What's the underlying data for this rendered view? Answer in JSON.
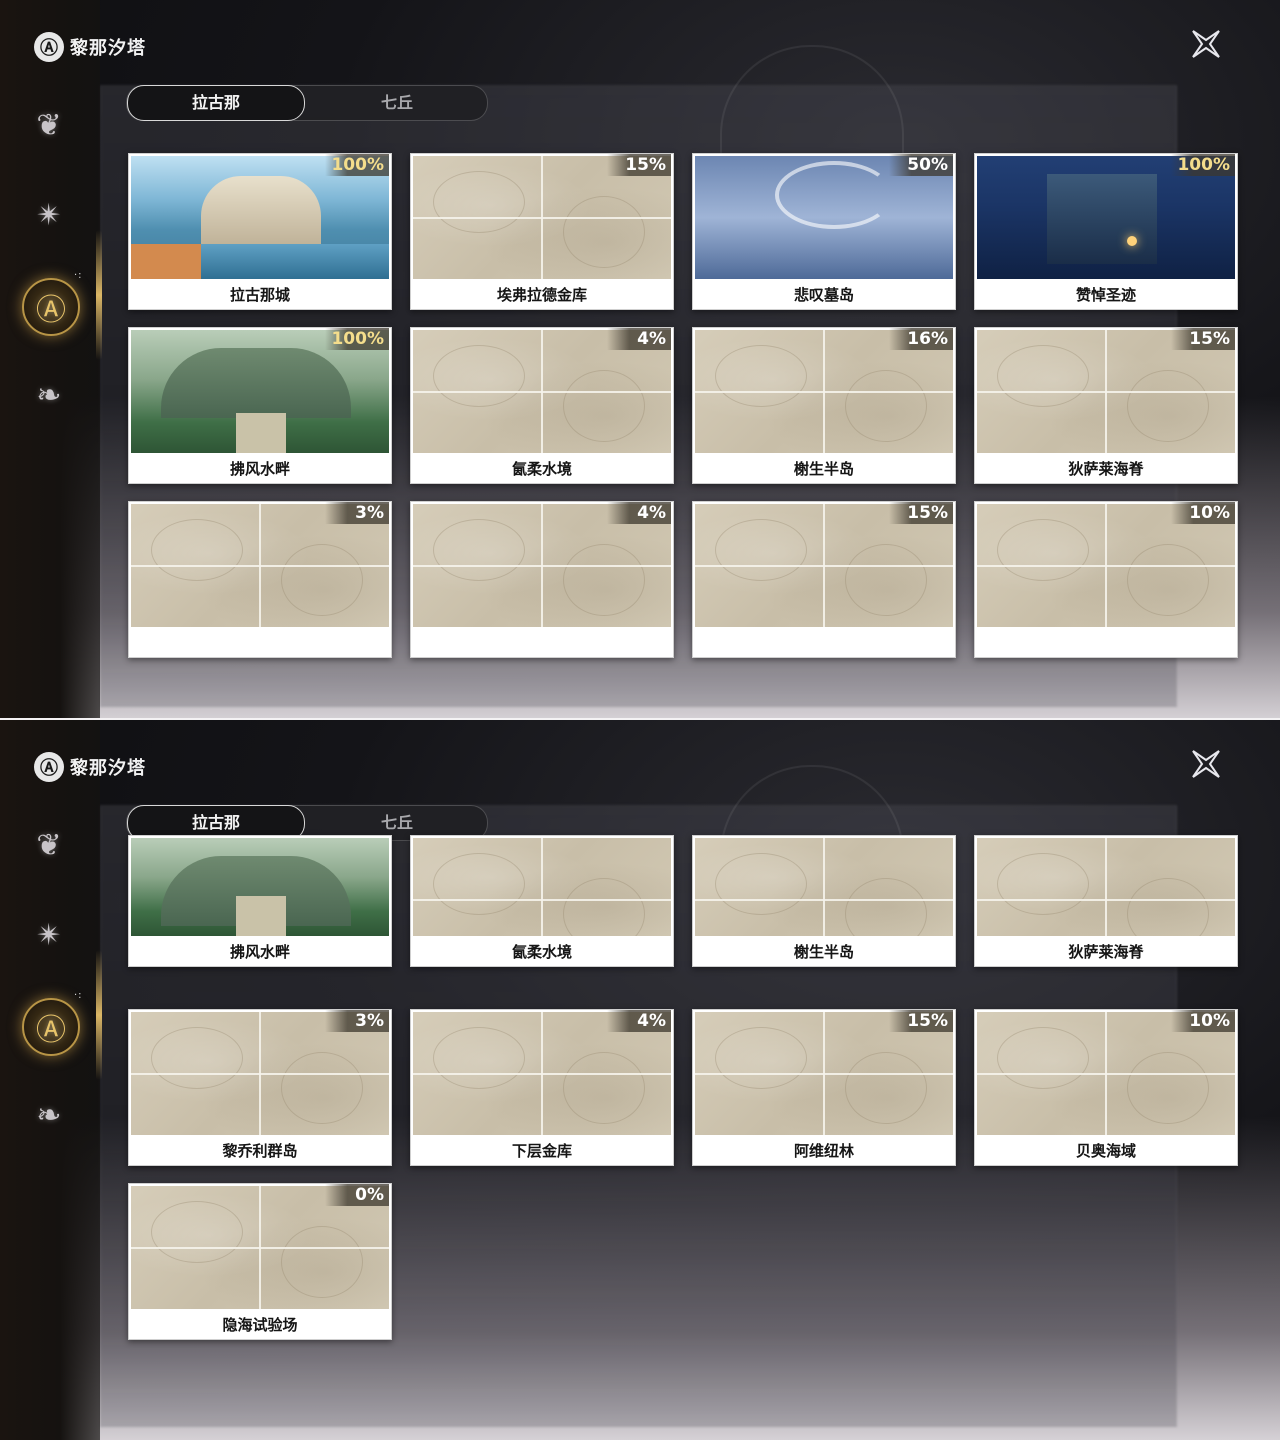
{
  "app": {
    "title": "黎那汐塔",
    "logo_glyph": "Ⓐ"
  },
  "tabs": [
    {
      "label": "拉古那",
      "active": true
    },
    {
      "label": "七丘",
      "active": false
    }
  ],
  "rail": [
    {
      "icon": "lotus-emblem-icon",
      "glyph": "❦"
    },
    {
      "icon": "star-emblem-icon",
      "glyph": "✴"
    },
    {
      "icon": "region-emblem-icon",
      "glyph": "Ⓐ",
      "active": true
    },
    {
      "icon": "bird-emblem-icon",
      "glyph": "❧"
    }
  ],
  "top_panel": {
    "cards": [
      {
        "name": "拉古那城",
        "progress": "100%",
        "scene": "city"
      },
      {
        "name": "埃弗拉德金库",
        "progress": "15%",
        "scene": "map"
      },
      {
        "name": "悲叹墓岛",
        "progress": "50%",
        "scene": "storm"
      },
      {
        "name": "赞悼圣迹",
        "progress": "100%",
        "scene": "night"
      },
      {
        "name": "拂风水畔",
        "progress": "100%",
        "scene": "garden"
      },
      {
        "name": "氤柔水境",
        "progress": "4%",
        "scene": "map"
      },
      {
        "name": "榭生半岛",
        "progress": "16%",
        "scene": "map"
      },
      {
        "name": "狄萨莱海脊",
        "progress": "15%",
        "scene": "map"
      },
      {
        "name": "",
        "progress": "3%",
        "scene": "map"
      },
      {
        "name": "",
        "progress": "4%",
        "scene": "map"
      },
      {
        "name": "",
        "progress": "15%",
        "scene": "map"
      },
      {
        "name": "",
        "progress": "10%",
        "scene": "map"
      }
    ]
  },
  "bottom_panel": {
    "cards": [
      {
        "name": "拂风水畔",
        "progress": "",
        "scene": "garden"
      },
      {
        "name": "氤柔水境",
        "progress": "",
        "scene": "map"
      },
      {
        "name": "榭生半岛",
        "progress": "",
        "scene": "map"
      },
      {
        "name": "狄萨莱海脊",
        "progress": "",
        "scene": "map"
      },
      {
        "name": "黎乔利群岛",
        "progress": "3%",
        "scene": "map"
      },
      {
        "name": "下层金库",
        "progress": "4%",
        "scene": "map"
      },
      {
        "name": "阿维纽林",
        "progress": "15%",
        "scene": "map"
      },
      {
        "name": "贝奥海域",
        "progress": "10%",
        "scene": "map"
      },
      {
        "name": "隐海试验场",
        "progress": "0%",
        "scene": "map"
      }
    ]
  }
}
